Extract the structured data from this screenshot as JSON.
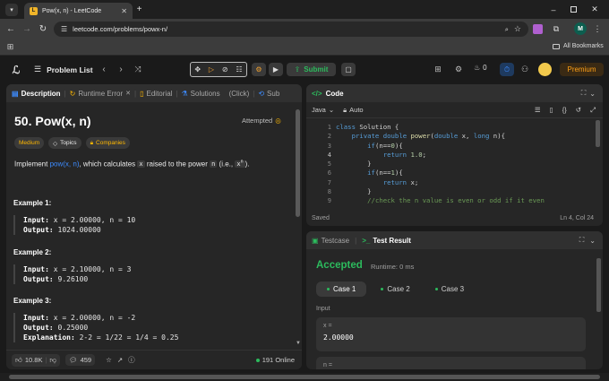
{
  "browser": {
    "tab_title": "Pow(x, n) - LeetCode",
    "url": "leetcode.com/problems/powx-n/",
    "all_bookmarks": "All Bookmarks",
    "profile_initial": "M"
  },
  "nav": {
    "problem_list": "Problem List",
    "submit": "Submit",
    "notifications_count": "0",
    "premium": "Premium"
  },
  "left_panel": {
    "tabs": [
      "Description",
      "Runtime Error",
      "Editorial",
      "Solutions",
      "(Click)",
      "Sub"
    ],
    "title": "50. Pow(x, n)",
    "attempted": "Attempted",
    "tags": {
      "difficulty": "Medium",
      "topics": "Topics",
      "companies": "Companies"
    },
    "statement": {
      "p1": "Implement ",
      "link": "pow(x, n)",
      "p2": ", which calculates ",
      "x": "x",
      "p3": " raised to the power ",
      "n": "n",
      "p4": " (i.e., ",
      "xn_base": "x",
      "xn_exp": "n",
      "p5": ")."
    },
    "examples": [
      {
        "title": "Example 1:",
        "input_label": "Input:",
        "input": " x = 2.00000, n = 10",
        "output_label": "Output:",
        "output": " 1024.00000"
      },
      {
        "title": "Example 2:",
        "input_label": "Input:",
        "input": " x = 2.10000, n = 3",
        "output_label": "Output:",
        "output": " 9.26100"
      },
      {
        "title": "Example 3:",
        "input_label": "Input:",
        "input": " x = 2.00000, n = -2",
        "output_label": "Output:",
        "output": " 0.25000",
        "explanation_label": "Explanation:",
        "explanation": " 2-2 = 1/22 = 1/4 = 0.25"
      }
    ],
    "footer": {
      "likes": "10.8K",
      "comments": "459",
      "online": "191 Online"
    }
  },
  "code_panel": {
    "title": "Code",
    "language": "Java",
    "mode": "Auto",
    "line_numbers": [
      "1",
      "2",
      "3",
      "4",
      "5",
      "6",
      "7",
      "8",
      "9"
    ],
    "lines": [
      "class Solution {",
      "    private double power(double x, long n){",
      "        if(n==0){",
      "            return 1.0;",
      "        }",
      "        if(n==1){",
      "            return x;",
      "        }",
      "        //check the n value is even or odd if it even"
    ],
    "status": "Saved",
    "cursor": "Ln 4, Col 24"
  },
  "result_panel": {
    "tabs": [
      "Testcase",
      "Test Result"
    ],
    "status": "Accepted",
    "runtime": "Runtime: 0 ms",
    "cases": [
      "Case 1",
      "Case 2",
      "Case 3"
    ],
    "input_label": "Input",
    "field_label": "x =",
    "field_value": "2.00000",
    "next_label": "n ="
  },
  "colors": {
    "accent_green": "#2cbb5d",
    "medium": "#ffb800",
    "link": "#3d8bfd",
    "premium": "#ffa116"
  }
}
